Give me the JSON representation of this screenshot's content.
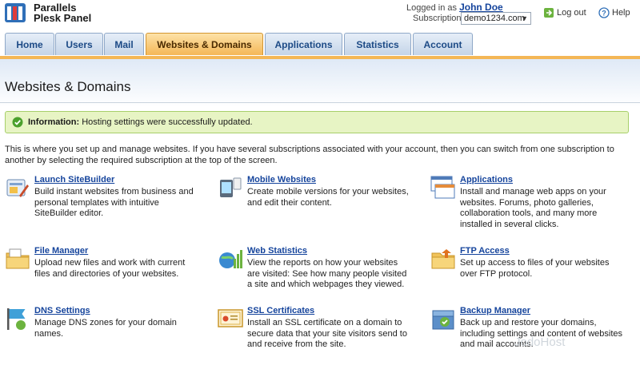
{
  "brand": {
    "line1": "Parallels",
    "line2": "Plesk Panel"
  },
  "login": {
    "prefix": "Logged in as",
    "user": "John Doe"
  },
  "subscription": {
    "label": "Subscription",
    "value": "demo1234.com"
  },
  "actions": {
    "logout": "Log out",
    "help": "Help"
  },
  "tabs": [
    {
      "label": "Home"
    },
    {
      "label": "Users"
    },
    {
      "label": "Mail"
    },
    {
      "label": "Websites & Domains"
    },
    {
      "label": "Applications"
    },
    {
      "label": "Statistics"
    },
    {
      "label": "Account"
    }
  ],
  "page": {
    "title": "Websites & Domains"
  },
  "message": {
    "label": "Information:",
    "text": " Hosting settings were successfully updated."
  },
  "intro": "This is where you set up and manage websites. If you have several subscriptions associated with your account, then you can switch from one subscription to another by selecting the required subscription at the top of the screen.",
  "tools": [
    {
      "title": "Launch SiteBuilder",
      "desc": "Build instant websites from business and personal templates with intuitive SiteBuilder editor.",
      "icon": "sitebuilder-icon"
    },
    {
      "title": "Mobile Websites",
      "desc": "Create mobile versions for your websites, and edit their content.",
      "icon": "mobile-icon"
    },
    {
      "title": "Applications",
      "desc": "Install and manage web apps on your websites. Forums, photo galleries, collaboration tools, and many more installed in several clicks.",
      "icon": "applications-icon"
    },
    {
      "title": "File Manager",
      "desc": "Upload new files and work with current files and directories of your websites.",
      "icon": "file-manager-icon"
    },
    {
      "title": "Web Statistics",
      "desc": "View the reports on how your websites are visited: See how many people visited a site and which webpages they viewed.",
      "icon": "web-statistics-icon"
    },
    {
      "title": "FTP Access",
      "desc": "Set up access to files of your websites over FTP protocol.",
      "icon": "ftp-icon"
    },
    {
      "title": "DNS Settings",
      "desc": "Manage DNS zones for your domain names.",
      "icon": "dns-icon"
    },
    {
      "title": "SSL Certificates",
      "desc": "Install an SSL certificate on a domain to secure data that your site visitors send to and receive from the site.",
      "icon": "ssl-certificate-icon"
    },
    {
      "title": "Backup Manager",
      "desc": "Back up and restore your domains, including settings and content of websites and mail accounts.",
      "icon": "backup-icon"
    }
  ],
  "watermark": "JodoHost",
  "colors": {
    "accent_tab": "#f4b756",
    "tab": "#c4d4e8",
    "link": "#15449c",
    "info_bg": "#e7f4c4"
  }
}
